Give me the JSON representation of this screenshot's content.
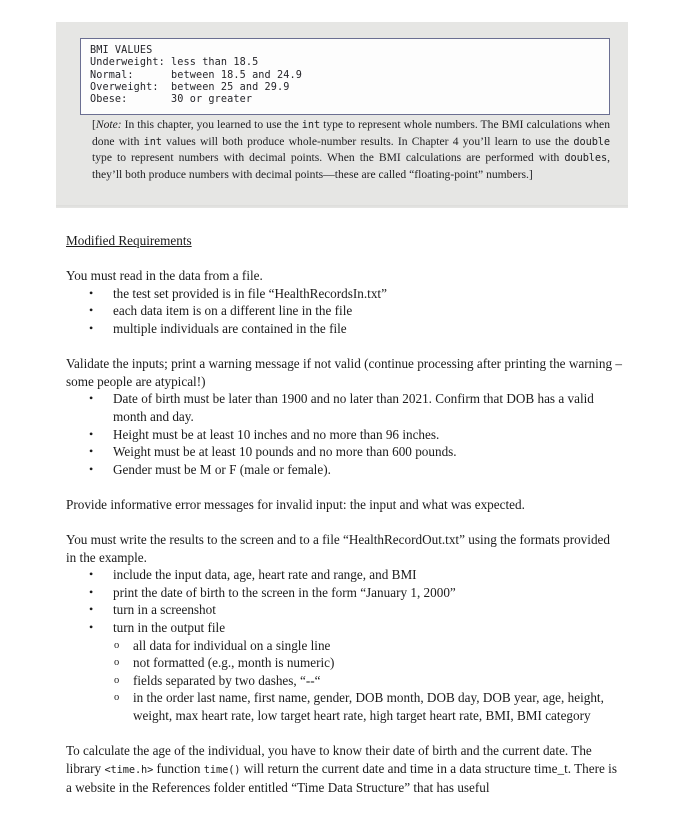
{
  "excerpt": {
    "code_box": {
      "lines": [
        "BMI VALUES",
        "Underweight: less than 18.5",
        "Normal:      between 18.5 and 24.9",
        "Overweight:  between 25 and 29.9",
        "Obese:       30 or greater"
      ]
    },
    "note": {
      "open_bracket": "[",
      "lead": "Note:",
      "text_1": " In this chapter, you learned to use the ",
      "code_1": "int",
      "text_2": " type to represent whole numbers. The BMI calculations when done with ",
      "code_2": "int",
      "text_3": " values will both produce whole-number results. In Chapter 4 you’ll learn to use the ",
      "code_3": "double",
      "text_4": " type to represent numbers with decimal points. When the BMI calculations are performed with ",
      "code_4": "doubles",
      "text_5": ", they’ll both produce numbers with decimal points—these are called “floating-point” numbers.]"
    }
  },
  "assignment": {
    "heading": "Modified Requirements",
    "intro_para": "You must read in the data from a file.",
    "intro_bullets": [
      "the test set provided is in file “HealthRecordsIn.txt”",
      "each data item is on a different line in the file",
      "multiple individuals are contained in the file"
    ],
    "validate_para": "Validate the inputs; print a warning message if not valid (continue processing after printing the warning – some people are atypical!)",
    "validate_bullets": [
      "Date of birth must be later than 1900 and no later than 2021. Confirm that DOB has a valid month and day.",
      "Height must be at least 10 inches and no more than 96 inches.",
      "Weight must be at least 10 pounds and no more than 600 pounds.",
      "Gender must be M or F (male or female)."
    ],
    "error_para": "Provide informative error messages for invalid input: the input and what was expected.",
    "output_para": "You must write the results to the screen and to a file “HealthRecordOut.txt” using the formats provided in the example.",
    "output_bullets": [
      "include the input data, age, heart rate and range, and BMI",
      "print the date of birth to the screen in the form “January 1, 2000”",
      "turn in a screenshot",
      "turn in the output file"
    ],
    "output_subbullets": [
      "all data for individual on a single line",
      "not formatted (e.g., month is numeric)",
      "fields separated by two dashes, “--“",
      "in the order last name, first name, gender, DOB month, DOB day, DOB year, age, height, weight, max heart rate, low target heart rate, high target heart rate, BMI, BMI category"
    ],
    "closing": {
      "text_1": "To calculate the age of the individual, you have to know their date of birth and the current date. The library ",
      "code_1": "<time.h>",
      "text_2": " function ",
      "code_2": "time()",
      "text_3": " will return the current date and time in a data structure time_t. There is a website in the References folder entitled “Time Data Structure” that has useful"
    }
  },
  "markers": {
    "bullet": "•",
    "circle": "o"
  }
}
